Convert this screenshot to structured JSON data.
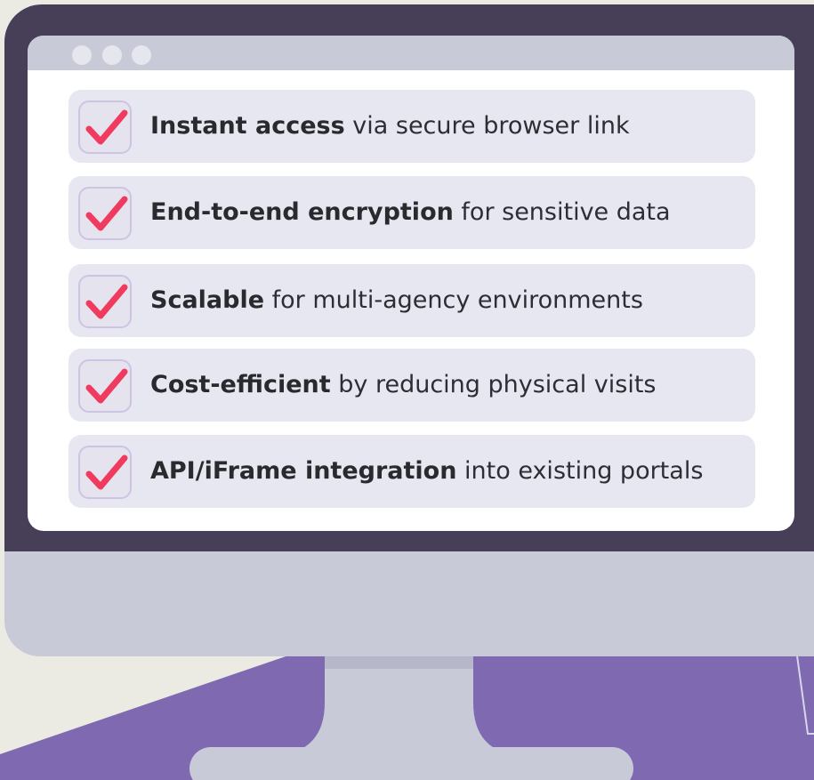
{
  "screen": {
    "window_dots": [
      "dot",
      "dot",
      "dot"
    ]
  },
  "features": [
    {
      "bold": "Instant access",
      "rest": " via secure browser link"
    },
    {
      "bold": "End-to-end encryption",
      "rest": " for sensitive data"
    },
    {
      "bold": "Scalable",
      "rest": " for multi-agency environments"
    },
    {
      "bold": "Cost-efficient",
      "rest": " by reducing physical visits"
    },
    {
      "bold": "API/iFrame integration",
      "rest": " into existing portals"
    }
  ],
  "colors": {
    "background": "#ebebe4",
    "frame": "#463f57",
    "chin": "#c9cad8",
    "floor": "#7f69b0",
    "check": "#f03a5f",
    "row": "#e7e7f1"
  },
  "icons": {
    "check": "checkmark-icon"
  }
}
